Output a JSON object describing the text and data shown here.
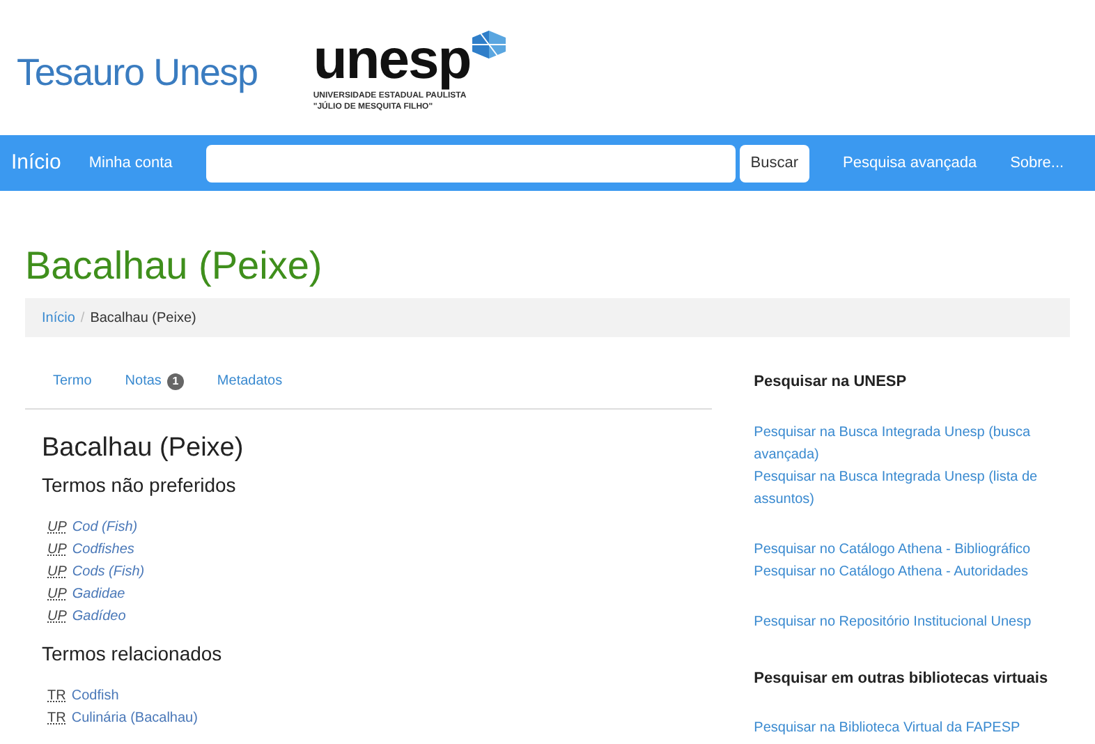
{
  "header": {
    "title": "Tesauro Unesp",
    "logo": {
      "wordmark": "unesp",
      "line_1": "UNIVERSIDADE ESTADUAL PAULISTA",
      "line_2": "\"JÚLIO DE MESQUITA FILHO\""
    }
  },
  "navbar": {
    "brand": "Início",
    "links_left": [
      "Minha conta"
    ],
    "search": {
      "button": "Buscar"
    },
    "links_right": [
      "Pesquisa avançada",
      "Sobre..."
    ]
  },
  "page_title": "Bacalhau (Peixe)",
  "breadcrumb": [
    {
      "label": "Início",
      "current": false
    },
    {
      "label": "Bacalhau (Peixe)",
      "current": true
    }
  ],
  "breadcrumb_separator": "/",
  "tabs": [
    {
      "label": "Termo"
    },
    {
      "label": "Notas",
      "badge": "1"
    },
    {
      "label": "Metadatos"
    }
  ],
  "term": {
    "title": "Bacalhau (Peixe)",
    "sections": [
      {
        "heading": "Termos não preferidos",
        "entries": [
          {
            "abbr": "UP",
            "label": "Cod (Fish)",
            "italic": true
          },
          {
            "abbr": "UP",
            "label": "Codfishes",
            "italic": true
          },
          {
            "abbr": "UP",
            "label": "Cods (Fish)",
            "italic": true
          },
          {
            "abbr": "UP",
            "label": "Gadidae",
            "italic": true
          },
          {
            "abbr": "UP",
            "label": "Gadídeo",
            "italic": true
          }
        ]
      },
      {
        "heading": "Termos relacionados",
        "entries": [
          {
            "abbr": "TR",
            "label": "Codfish",
            "italic": false
          },
          {
            "abbr": "TR",
            "label": "Culinária (Bacalhau)",
            "italic": false
          }
        ]
      }
    ]
  },
  "sidebar": [
    {
      "heading": "Pesquisar na UNESP",
      "groups": [
        [
          "Pesquisar na Busca Integrada Unesp (busca avançada)",
          "Pesquisar na Busca Integrada Unesp (lista de assuntos)"
        ],
        [
          "Pesquisar no Catálogo Athena - Bibliográfico",
          "Pesquisar no Catálogo Athena - Autoridades"
        ],
        [
          "Pesquisar no Repositório Institucional Unesp"
        ]
      ]
    },
    {
      "heading": "Pesquisar em outras bibliotecas virtuais",
      "groups": [
        [
          "Pesquisar na Biblioteca Virtual da FAPESP"
        ]
      ]
    }
  ]
}
